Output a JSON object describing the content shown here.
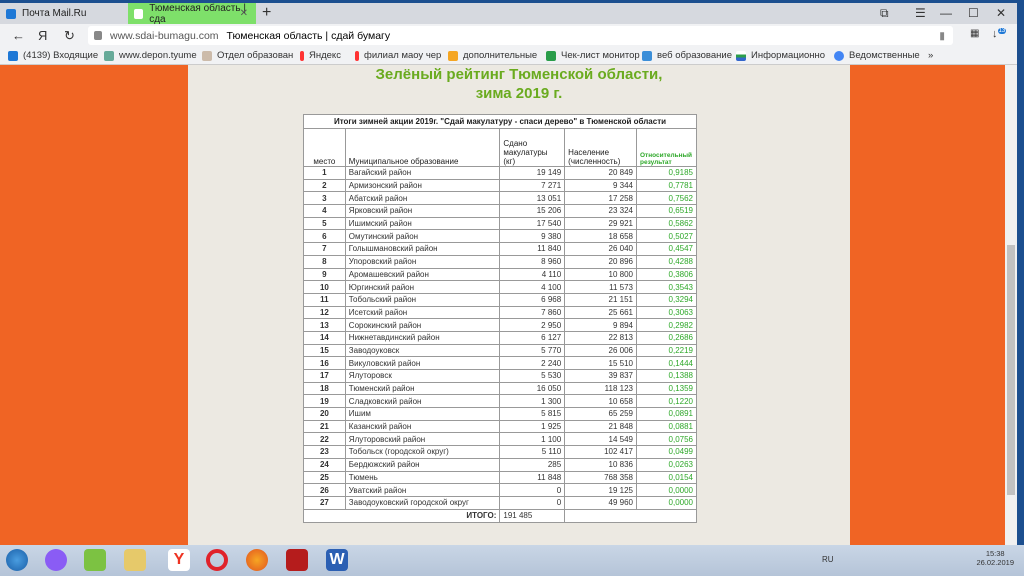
{
  "browser": {
    "tabs": [
      {
        "label": "Почта Mail.Ru",
        "color": "#1e78d6"
      },
      {
        "label": "Тюменская область | сда",
        "color": "#ffffff",
        "active": true
      }
    ],
    "url_domain": "www.sdai-bumagu.com",
    "url_title": "Тюменская область | сдай бумагу",
    "download_badge": "13",
    "bookmarks": [
      {
        "label": "(4139) Входящие",
        "color": "#1e78d6"
      },
      {
        "label": "www.depon.tyume",
        "color": "#6a9"
      },
      {
        "label": "Отдел образован",
        "color": "#cba"
      },
      {
        "label": "Яндекс",
        "color": "#f33"
      },
      {
        "label": "филиал маоу чер",
        "color": "#f33"
      },
      {
        "label": "дополнительные",
        "color": "#f5a623"
      },
      {
        "label": "Чек-лист монитор",
        "color": "#2a9d4a"
      },
      {
        "label": "веб образование",
        "color": "#3b8ed8"
      },
      {
        "label": "Информационно",
        "color": "#c33"
      },
      {
        "label": "Ведомственные",
        "color": "#4285f4"
      }
    ],
    "bookmarks_more": "»"
  },
  "page": {
    "title_line1": "Зелёный рейтинг Тюменской области,",
    "title_line2": "зима 2019 г.",
    "table": {
      "caption": "Итоги зимней акции 2019г. \"Сдай макулатуру - спаси дерево\" в Тюменской области",
      "headers": [
        "место",
        "Муниципальное образование",
        "Сдано макулатуры (кг)",
        "Население (численность)",
        "Относительный результат"
      ],
      "rows": [
        [
          "1",
          "Вагайский район",
          "19 149",
          "20 849",
          "0,9185"
        ],
        [
          "2",
          "Армизонский район",
          "7 271",
          "9 344",
          "0,7781"
        ],
        [
          "3",
          "Абатский район",
          "13 051",
          "17 258",
          "0,7562"
        ],
        [
          "4",
          "Ярковский район",
          "15 206",
          "23 324",
          "0,6519"
        ],
        [
          "5",
          "Ишимский район",
          "17 540",
          "29 921",
          "0,5862"
        ],
        [
          "6",
          "Омутинский район",
          "9 380",
          "18 658",
          "0,5027"
        ],
        [
          "7",
          "Голышмановский район",
          "11 840",
          "26 040",
          "0,4547"
        ],
        [
          "8",
          "Упоровский район",
          "8 960",
          "20 896",
          "0,4288"
        ],
        [
          "9",
          "Аромашевский район",
          "4 110",
          "10 800",
          "0,3806"
        ],
        [
          "10",
          "Юргинский район",
          "4 100",
          "11 573",
          "0,3543"
        ],
        [
          "11",
          "Тобольский район",
          "6 968",
          "21 151",
          "0,3294"
        ],
        [
          "12",
          "Исетский район",
          "7 860",
          "25 661",
          "0,3063"
        ],
        [
          "13",
          "Сорокинский район",
          "2 950",
          "9 894",
          "0,2982"
        ],
        [
          "14",
          "Нижнетавдинский район",
          "6 127",
          "22 813",
          "0,2686"
        ],
        [
          "15",
          "Заводоуковск",
          "5 770",
          "26 006",
          "0,2219"
        ],
        [
          "16",
          "Викуловский район",
          "2 240",
          "15 510",
          "0,1444"
        ],
        [
          "17",
          "Ялуторовск",
          "5 530",
          "39 837",
          "0,1388"
        ],
        [
          "18",
          "Тюменский район",
          "16 050",
          "118 123",
          "0,1359"
        ],
        [
          "19",
          "Сладковский район",
          "1 300",
          "10 658",
          "0,1220"
        ],
        [
          "20",
          "Ишим",
          "5 815",
          "65 259",
          "0,0891"
        ],
        [
          "21",
          "Казанский район",
          "1 925",
          "21 848",
          "0,0881"
        ],
        [
          "22",
          "Ялуторовский район",
          "1 100",
          "14 549",
          "0,0756"
        ],
        [
          "23",
          "Тобольск (городской округ)",
          "5 110",
          "102 417",
          "0,0499"
        ],
        [
          "24",
          "Бердюжский район",
          "285",
          "10 836",
          "0,0263"
        ],
        [
          "25",
          "Тюмень",
          "11 848",
          "768 358",
          "0,0154"
        ],
        [
          "26",
          "Уватский район",
          "0",
          "19 125",
          "0,0000"
        ],
        [
          "27",
          "Заводоуковский городской округ",
          "0",
          "49 960",
          "0,0000"
        ]
      ],
      "total_label": "ИТОГО:",
      "total_value": "191 485"
    }
  },
  "taskbar": {
    "lang": "RU",
    "time": "15:38",
    "date": "26.02.2019"
  },
  "colors": {
    "orange": "#f06424",
    "title_green": "#6aab1f",
    "result_green": "#2fa82a"
  }
}
